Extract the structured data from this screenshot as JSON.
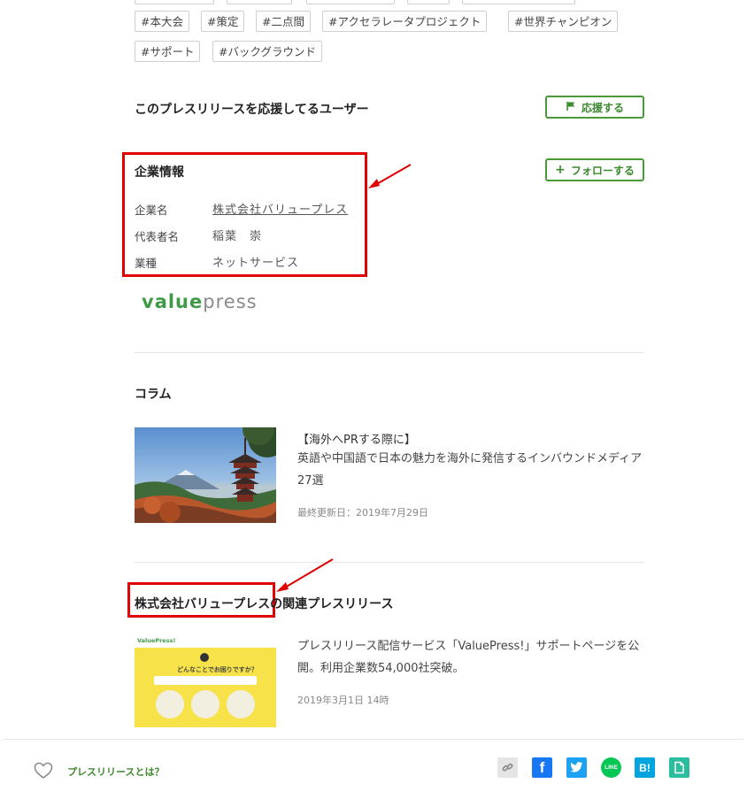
{
  "tags": [
    "#本大会",
    "#策定",
    "#二点間",
    "#アクセラレータプロジェクト",
    "#世界チャンピオン",
    "#サポート",
    "#バックグラウンド"
  ],
  "supporters": {
    "heading": "このプレスリリースを応援してるユーザー",
    "support_button": "応援する"
  },
  "company": {
    "heading": "企業情報",
    "follow_button": "フォローする",
    "rows": [
      {
        "label": "企業名",
        "value": "株式会社バリュープレス"
      },
      {
        "label": "代表者名",
        "value": "稲葉　崇"
      },
      {
        "label": "業種",
        "value": "ネットサービス"
      }
    ],
    "logo_text_a": "value",
    "logo_text_b": "press"
  },
  "column": {
    "heading": "コラム",
    "title": "【海外へPRする際に】",
    "text": "英語や中国語で日本の魅力を海外に発信するインバウンドメディア27選",
    "meta": "最終更新日：2019年7月29日"
  },
  "related": {
    "heading": "株式会社バリュープレスの関連プレスリリース",
    "text": "プレスリリース配信サービス「ValuePress!」サポートページを公開。利用企業数54,000社突破。",
    "meta": "2019年3月1日 14時",
    "thumb_brand": "ValuePress!",
    "thumb_question": "どんなことでお困りですか？"
  },
  "footer": {
    "what_is_link": "プレスリリースとは？"
  },
  "colors": {
    "accent_green": "#4a9a3a",
    "annotation_red": "#e00000",
    "facebook": "#1877f2",
    "twitter": "#1da1f2",
    "line": "#06c755",
    "hatena": "#00a4de",
    "pocket": "#2bbd9e"
  },
  "icons": [
    "flag-icon",
    "plus-icon",
    "heart-icon",
    "link-icon",
    "facebook-icon",
    "twitter-icon",
    "line-icon",
    "hatena-bookmark-icon",
    "note-icon"
  ]
}
